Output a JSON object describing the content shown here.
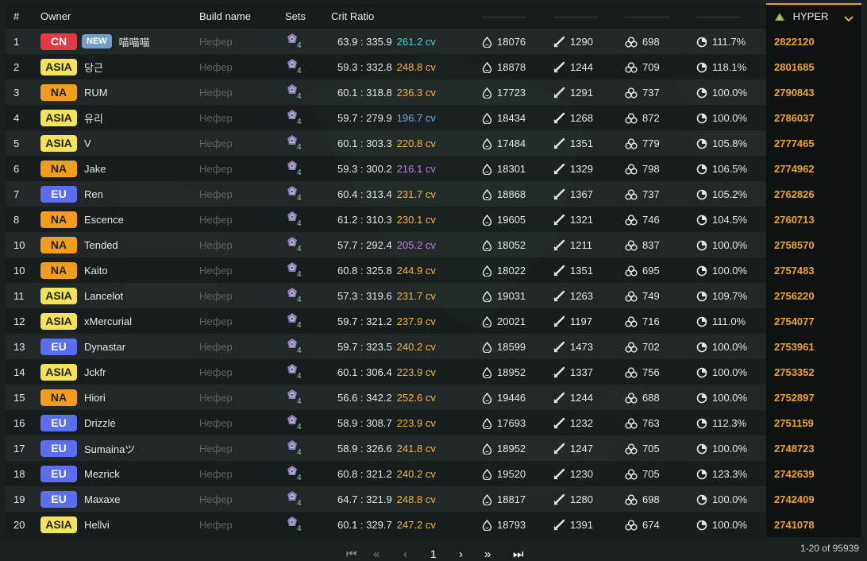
{
  "header": {
    "rank": "#",
    "owner": "Owner",
    "build_name": "Build name",
    "sets": "Sets",
    "crit_ratio": "Crit Ratio",
    "hyper": "HYPER"
  },
  "rows": [
    {
      "rank": "1",
      "region": "CN",
      "new": "NEW",
      "name": "喵喵喵",
      "build": "Нефер",
      "set_count": "4",
      "ratio": "63.9 : 335.9",
      "cv": "261.2 cv",
      "cv_color": "#3ad0d8",
      "hp": "18076",
      "atk": "1290",
      "em": "698",
      "er": "111.7%",
      "hyper": "2822120"
    },
    {
      "rank": "2",
      "region": "ASIA",
      "new": "",
      "name": "당근",
      "build": "Нефер",
      "set_count": "4",
      "ratio": "59.3 : 332.8",
      "cv": "248.8 cv",
      "cv_color": "#f2b43a",
      "hp": "18878",
      "atk": "1244",
      "em": "709",
      "er": "118.1%",
      "hyper": "2801685"
    },
    {
      "rank": "3",
      "region": "NA",
      "new": "",
      "name": "RUM",
      "build": "Нефер",
      "set_count": "4",
      "ratio": "60.1 : 318.8",
      "cv": "236.3 cv",
      "cv_color": "#f2b43a",
      "hp": "17723",
      "atk": "1291",
      "em": "737",
      "er": "100.0%",
      "hyper": "2790843"
    },
    {
      "rank": "4",
      "region": "ASIA",
      "new": "",
      "name": "유리",
      "build": "Нефер",
      "set_count": "4",
      "ratio": "59.7 : 279.9",
      "cv": "196.7 cv",
      "cv_color": "#6fa8e8",
      "hp": "18434",
      "atk": "1268",
      "em": "872",
      "er": "100.0%",
      "hyper": "2786037"
    },
    {
      "rank": "5",
      "region": "ASIA",
      "new": "",
      "name": "V",
      "build": "Нефер",
      "set_count": "4",
      "ratio": "60.1 : 303.3",
      "cv": "220.8 cv",
      "cv_color": "#f2b43a",
      "hp": "17484",
      "atk": "1351",
      "em": "779",
      "er": "105.8%",
      "hyper": "2777465"
    },
    {
      "rank": "6",
      "region": "NA",
      "new": "",
      "name": "Jake",
      "build": "Нефер",
      "set_count": "4",
      "ratio": "59.3 : 300.2",
      "cv": "216.1 cv",
      "cv_color": "#c07be8",
      "hp": "18301",
      "atk": "1329",
      "em": "798",
      "er": "106.5%",
      "hyper": "2774962"
    },
    {
      "rank": "7",
      "region": "EU",
      "new": "",
      "name": "Ren",
      "build": "Нефер",
      "set_count": "4",
      "ratio": "60.4 : 313.4",
      "cv": "231.7 cv",
      "cv_color": "#f2b43a",
      "hp": "18868",
      "atk": "1367",
      "em": "737",
      "er": "105.2%",
      "hyper": "2762826"
    },
    {
      "rank": "8",
      "region": "NA",
      "new": "",
      "name": "Escence",
      "build": "Нефер",
      "set_count": "4",
      "ratio": "61.2 : 310.3",
      "cv": "230.1 cv",
      "cv_color": "#f2b43a",
      "hp": "19605",
      "atk": "1321",
      "em": "746",
      "er": "104.5%",
      "hyper": "2760713"
    },
    {
      "rank": "10",
      "region": "NA",
      "new": "",
      "name": "Tended",
      "build": "Нефер",
      "set_count": "4",
      "ratio": "57.7 : 292.4",
      "cv": "205.2 cv",
      "cv_color": "#c07be8",
      "hp": "18052",
      "atk": "1211",
      "em": "837",
      "er": "100.0%",
      "hyper": "2758570"
    },
    {
      "rank": "10",
      "region": "NA",
      "new": "",
      "name": "Kaito",
      "build": "Нефер",
      "set_count": "4",
      "ratio": "60.8 : 325.8",
      "cv": "244.9 cv",
      "cv_color": "#f2b43a",
      "hp": "18022",
      "atk": "1351",
      "em": "695",
      "er": "100.0%",
      "hyper": "2757483"
    },
    {
      "rank": "11",
      "region": "ASIA",
      "new": "",
      "name": "Lancelot",
      "build": "Нефер",
      "set_count": "4",
      "ratio": "57.3 : 319.6",
      "cv": "231.7 cv",
      "cv_color": "#f2b43a",
      "hp": "19031",
      "atk": "1263",
      "em": "749",
      "er": "109.7%",
      "hyper": "2756220"
    },
    {
      "rank": "12",
      "region": "ASIA",
      "new": "",
      "name": "xMercurial",
      "build": "Нефер",
      "set_count": "4",
      "ratio": "59.7 : 321.2",
      "cv": "237.9 cv",
      "cv_color": "#f2b43a",
      "hp": "20021",
      "atk": "1197",
      "em": "716",
      "er": "111.0%",
      "hyper": "2754077"
    },
    {
      "rank": "13",
      "region": "EU",
      "new": "",
      "name": "Dynastar",
      "build": "Нефер",
      "set_count": "4",
      "ratio": "59.7 : 323.5",
      "cv": "240.2 cv",
      "cv_color": "#f2b43a",
      "hp": "18599",
      "atk": "1473",
      "em": "702",
      "er": "100.0%",
      "hyper": "2753961"
    },
    {
      "rank": "14",
      "region": "ASIA",
      "new": "",
      "name": "Jckfr",
      "build": "Нефер",
      "set_count": "4",
      "ratio": "60.1 : 306.4",
      "cv": "223.9 cv",
      "cv_color": "#f2b43a",
      "hp": "18952",
      "atk": "1337",
      "em": "756",
      "er": "100.0%",
      "hyper": "2753352"
    },
    {
      "rank": "15",
      "region": "NA",
      "new": "",
      "name": "Hiori",
      "build": "Нефер",
      "set_count": "4",
      "ratio": "56.6 : 342.2",
      "cv": "252.6 cv",
      "cv_color": "#f2b43a",
      "hp": "19446",
      "atk": "1244",
      "em": "688",
      "er": "100.0%",
      "hyper": "2752897"
    },
    {
      "rank": "16",
      "region": "EU",
      "new": "",
      "name": "Drizzle",
      "build": "Нефер",
      "set_count": "4",
      "ratio": "58.9 : 308.7",
      "cv": "223.9 cv",
      "cv_color": "#f2b43a",
      "hp": "17693",
      "atk": "1232",
      "em": "763",
      "er": "112.3%",
      "hyper": "2751159"
    },
    {
      "rank": "17",
      "region": "EU",
      "new": "",
      "name": "Sumainaツ",
      "build": "Нефер",
      "set_count": "4",
      "ratio": "58.9 : 326.6",
      "cv": "241.8 cv",
      "cv_color": "#f2b43a",
      "hp": "18952",
      "atk": "1247",
      "em": "705",
      "er": "100.0%",
      "hyper": "2748723"
    },
    {
      "rank": "18",
      "region": "EU",
      "new": "",
      "name": "Mezrick",
      "build": "Нефер",
      "set_count": "4",
      "ratio": "60.8 : 321.2",
      "cv": "240.2 cv",
      "cv_color": "#f2b43a",
      "hp": "19520",
      "atk": "1230",
      "em": "705",
      "er": "123.3%",
      "hyper": "2742639"
    },
    {
      "rank": "19",
      "region": "EU",
      "new": "",
      "name": "Maxaxe",
      "build": "Нефер",
      "set_count": "4",
      "ratio": "64.7 : 321.9",
      "cv": "248.8 cv",
      "cv_color": "#f2b43a",
      "hp": "18817",
      "atk": "1280",
      "em": "698",
      "er": "100.0%",
      "hyper": "2742409"
    },
    {
      "rank": "20",
      "region": "ASIA",
      "new": "",
      "name": "Hellvi",
      "build": "Нефер",
      "set_count": "4",
      "ratio": "60.1 : 329.7",
      "cv": "247.2 cv",
      "cv_color": "#f2b43a",
      "hp": "18793",
      "atk": "1391",
      "em": "674",
      "er": "100.0%",
      "hyper": "2741078"
    }
  ],
  "icons": {
    "hp": "drop-icon",
    "atk": "sword-icon",
    "em": "triple-circle-icon",
    "er": "recharge-icon",
    "set": "artifact-set-icon",
    "hyper": "hyper-triangle-icon",
    "dropdown": "chevron-down-icon"
  },
  "colors": {
    "accent": "#f0a32a",
    "region_CN": "#e53946",
    "region_ASIA": "#f2e35b",
    "region_NA": "#f29d1c",
    "region_EU": "#5a6ef0"
  },
  "pagination": {
    "first": "⏮",
    "double_prev": "«",
    "prev": "‹",
    "current": "1",
    "next": "›",
    "double_next": "»",
    "last": "⏭",
    "info": "1-20 of 95939"
  }
}
